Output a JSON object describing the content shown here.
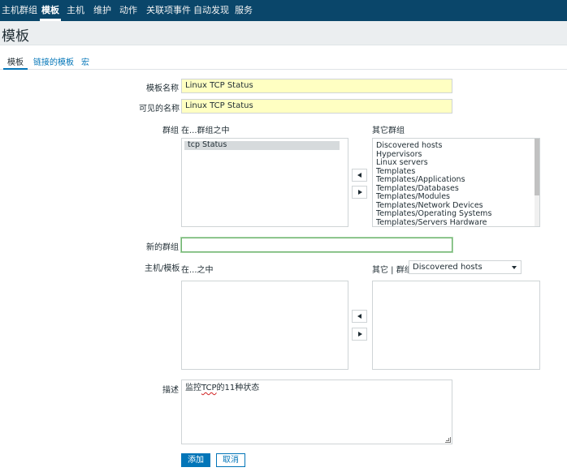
{
  "topnav": {
    "items": [
      {
        "label": "主机群组"
      },
      {
        "label": "模板"
      },
      {
        "label": "主机"
      },
      {
        "label": "维护"
      },
      {
        "label": "动作"
      },
      {
        "label": "关联项事件"
      },
      {
        "label": "自动发现"
      },
      {
        "label": "服务"
      }
    ],
    "active": "模板"
  },
  "header": {
    "title": "模板"
  },
  "tabs": [
    {
      "label": "模板"
    },
    {
      "label": "链接的模板"
    },
    {
      "label": "宏"
    }
  ],
  "form": {
    "template_name": {
      "label": "模板名称",
      "value": "Linux TCP Status"
    },
    "visible_name": {
      "label": "可见的名称",
      "value": "Linux TCP Status"
    },
    "groups": {
      "label": "群组",
      "in_label": "在...群组之中",
      "other_label": "其它群组",
      "in_items": [
        "tcp Status"
      ],
      "other_items": [
        "Discovered hosts",
        "Hypervisors",
        "Linux servers",
        "Templates",
        "Templates/Applications",
        "Templates/Databases",
        "Templates/Modules",
        "Templates/Network Devices",
        "Templates/Operating Systems",
        "Templates/Servers Hardware"
      ]
    },
    "new_group": {
      "label": "新的群组",
      "value": ""
    },
    "hosts_templates": {
      "label": "主机/模板",
      "in_label": "在...之中",
      "other_label": "其它 | 群组",
      "group_select": "Discovered hosts"
    },
    "description": {
      "label": "描述",
      "prefix": "监控",
      "misspelled": "TCP",
      "suffix": "的11种状态"
    }
  },
  "buttons": {
    "add": "添加",
    "cancel": "取消"
  },
  "colors": {
    "nav_bg": "#0a466a",
    "accent": "#0275b8",
    "field_highlight": "#ffffc2"
  }
}
